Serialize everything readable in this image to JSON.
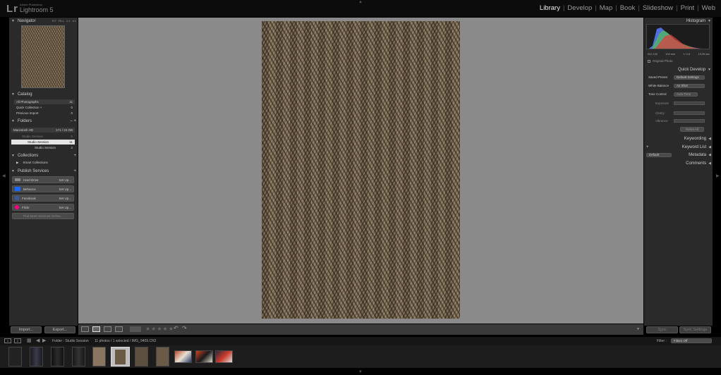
{
  "app": {
    "logo": "Lr",
    "adobe": "Adobe Photoshop",
    "name": "Lightroom 5"
  },
  "modules": [
    "Library",
    "Develop",
    "Map",
    "Book",
    "Slideshow",
    "Print",
    "Web"
  ],
  "active_module": "Library",
  "left": {
    "navigator": {
      "title": "Navigator",
      "zoom": [
        "FIT",
        "FILL",
        "1:1",
        "4:1"
      ]
    },
    "catalog": {
      "title": "Catalog",
      "items": [
        {
          "label": "All Photographs",
          "count": "11"
        },
        {
          "label": "Quick Collection +",
          "count": "0"
        },
        {
          "label": "Previous Import",
          "count": "0"
        }
      ]
    },
    "folders": {
      "title": "Folders",
      "volume": "Macintosh HD",
      "volume_size": "171 / 24 GB",
      "items": [
        {
          "label": "Studio Session",
          "count": "0"
        },
        {
          "label": "Studio Session",
          "count": "11"
        },
        {
          "label": "Studio Session",
          "count": "2"
        }
      ]
    },
    "collections": {
      "title": "Collections",
      "items": [
        {
          "label": "Smart Collections"
        }
      ]
    },
    "publish": {
      "title": "Publish Services",
      "items": [
        {
          "label": "Hard Drive",
          "action": "Set Up..."
        },
        {
          "label": "Behance",
          "action": "Set Up..."
        },
        {
          "label": "Facebook",
          "action": "Set Up..."
        },
        {
          "label": "Flickr",
          "action": "Set Up..."
        }
      ],
      "more": "Find More Services Online..."
    },
    "import": "Import...",
    "export": "Export..."
  },
  "right": {
    "histogram": {
      "title": "Histogram",
      "iso": "ISO 100",
      "focal": "100 mm",
      "aperture": "f / 2.8",
      "shutter": "1/125 sec",
      "original": "Original Photo"
    },
    "quick_develop": {
      "title": "Quick Develop",
      "saved_preset_label": "Saved Preset",
      "saved_preset": "Default Settings",
      "wb_label": "White Balance",
      "wb": "As Shot",
      "tone_label": "Tone Control",
      "auto_tone": "Auto Tone",
      "exposure": "Exposure",
      "clarity": "Clarity",
      "vibrance": "Vibrance",
      "reset": "Reset All"
    },
    "keywording": "Keywording",
    "keyword_list": "Keyword List",
    "metadata": "Metadata",
    "metadata_preset": "Default",
    "comments": "Comments",
    "sync": "Sync",
    "sync_settings": "Sync Settings"
  },
  "filmbar": {
    "page1": "1",
    "page2": "2",
    "folder": "Folder : Studio Session",
    "info": "11 photos / 1 selected / IMG_9409.CR2",
    "filter_label": "Filter :",
    "filter_value": "Filters Off"
  },
  "stars": "★★★★★"
}
